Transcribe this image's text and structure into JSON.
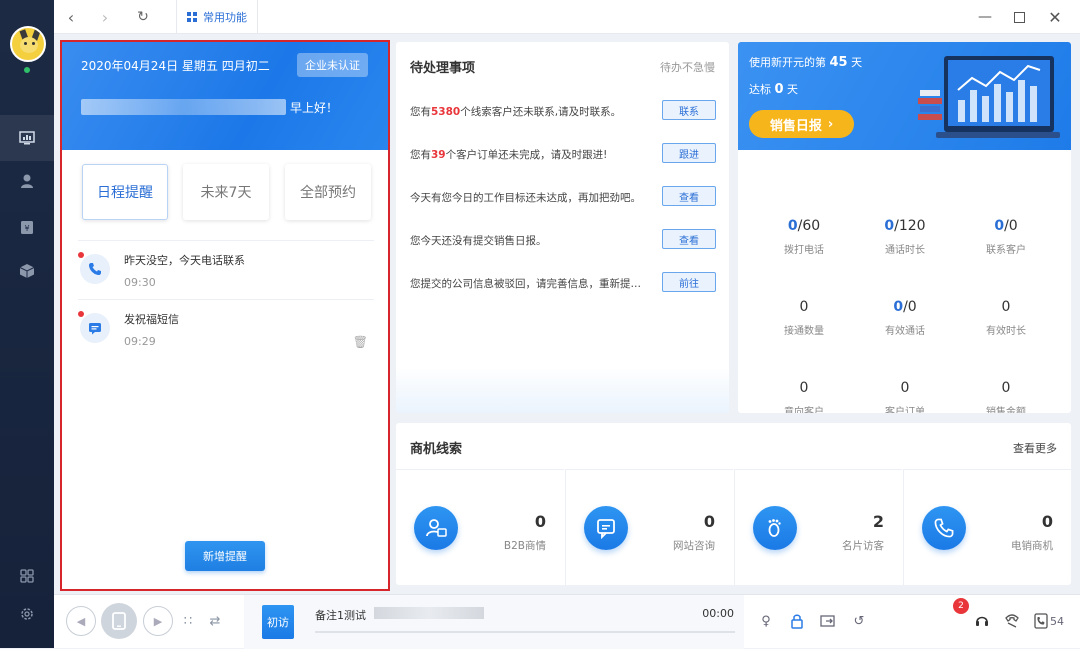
{
  "topbar": {
    "tab_label": "常用功能"
  },
  "today": {
    "date": "2020年04月24日 星期五 四月初二",
    "company_badge": "企业未认证",
    "greeting": "早上好！"
  },
  "schedule": {
    "tabs": [
      "日程提醒",
      "未来7天",
      "全部预约"
    ],
    "active_tab": "日程提醒",
    "reminders": [
      {
        "title": "昨天没空，今天电话联系",
        "time": "09:30",
        "icon": "phone-icon"
      },
      {
        "title": "发祝福短信",
        "time": "09:29",
        "icon": "message-icon"
      }
    ],
    "add_button": "新增提醒"
  },
  "pending": {
    "title": "待处理事项",
    "more": "待办不急慢",
    "items": [
      {
        "pre": "您有",
        "num": "5380",
        "post": "个线索客户还未联系,请及时联系。",
        "button": "联系"
      },
      {
        "pre": "您有",
        "num": "39",
        "post": "个客户订单还未完成，请及时跟进!",
        "button": "跟进"
      },
      {
        "pre": "",
        "num": "",
        "post": "今天有您今日的工作目标还未达成，再加把劲吧。",
        "button": "查看"
      },
      {
        "pre": "",
        "num": "",
        "post": "您今天还没有提交销售日报。",
        "button": "查看"
      },
      {
        "pre": "",
        "num": "",
        "post": "您提交的公司信息被驳回，请完善信息，重新提交...",
        "button": "前往"
      }
    ]
  },
  "sales": {
    "line1_prefix": "使用新开元的第",
    "days_used": "45",
    "line1_suffix": "天",
    "line2_prefix": "达标",
    "days_reached": "0",
    "line2_suffix": "天",
    "report_button": "销售日报",
    "stats": [
      {
        "value_hl": "0",
        "value_rest": "/60",
        "label": "拨打电话"
      },
      {
        "value_hl": "0",
        "value_rest": "/120",
        "label": "通话时长"
      },
      {
        "value_hl": "0",
        "value_rest": "/0",
        "label": "联系客户"
      },
      {
        "value_hl": "",
        "value_rest": "0",
        "label": "接通数量"
      },
      {
        "value_hl": "0",
        "value_rest": "/0",
        "label": "有效通话"
      },
      {
        "value_hl": "",
        "value_rest": "0",
        "label": "有效时长"
      },
      {
        "value_hl": "",
        "value_rest": "0",
        "label": "意向客户"
      },
      {
        "value_hl": "",
        "value_rest": "0",
        "label": "客户订单"
      },
      {
        "value_hl": "",
        "value_rest": "0",
        "label": "销售金额"
      }
    ]
  },
  "business": {
    "title": "商机线索",
    "more": "查看更多",
    "cells": [
      {
        "value": "0",
        "label": "B2B商情",
        "icon": "user-card-icon"
      },
      {
        "value": "0",
        "label": "网站咨询",
        "icon": "chat-icon"
      },
      {
        "value": "2",
        "label": "名片访客",
        "icon": "footprint-icon"
      },
      {
        "value": "0",
        "label": "电销商机",
        "icon": "phone-icon"
      }
    ]
  },
  "callbar": {
    "first_visit": "初访",
    "note_label": "备注1测试",
    "timer": "00:00",
    "notification_count": "2",
    "line_number": "54"
  },
  "colors": {
    "accent": "#1f7fe3",
    "sidebar": "#1c2a44",
    "highlight_red": "#e8363b",
    "report_yellow": "#f7b51c"
  }
}
